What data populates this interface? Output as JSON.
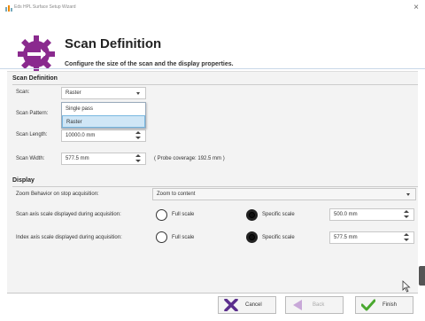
{
  "window": {
    "title": "Eds HPL Surface Setup Wizard",
    "close_glyph": "×"
  },
  "header": {
    "title": "Scan Definition",
    "subtitle": "Configure the size of the scan and the display properties."
  },
  "scan_definition": {
    "section_title": "Scan Definition",
    "scan_label": "Scan:",
    "scan_value": "Raster",
    "scan_options": [
      "Single pass",
      "Raster"
    ],
    "scan_selected": "Raster",
    "scan_pattern_label": "Scan Pattern:",
    "scan_length_label": "Scan Length:",
    "scan_length_value": "10000.0 mm",
    "scan_width_label": "Scan Width:",
    "scan_width_value": "577.5 mm",
    "probe_coverage": "( Probe coverage: 192.5 mm )"
  },
  "display": {
    "section_title": "Display",
    "zoom_label": "Zoom Behavior on stop acquisition:",
    "zoom_value": "Zoom to content",
    "scan_axis_label": "Scan axis scale displayed during acquisition:",
    "scan_axis_full": "Full scale",
    "scan_axis_specific": "Specific scale",
    "scan_axis_value": "500.0 mm",
    "index_axis_label": "Index axis scale displayed during acquisition:",
    "index_axis_full": "Full scale",
    "index_axis_specific": "Specific scale",
    "index_axis_value": "577.5 mm"
  },
  "footer": {
    "cancel_label": "Cancel",
    "back_label": "Back",
    "finish_label": "Finish"
  },
  "colors": {
    "logo_purple": "#8a2a8e",
    "cancel_x": "#5a2d8c",
    "back_arrow": "#c8a8d8",
    "finish_check": "#4aa830"
  }
}
